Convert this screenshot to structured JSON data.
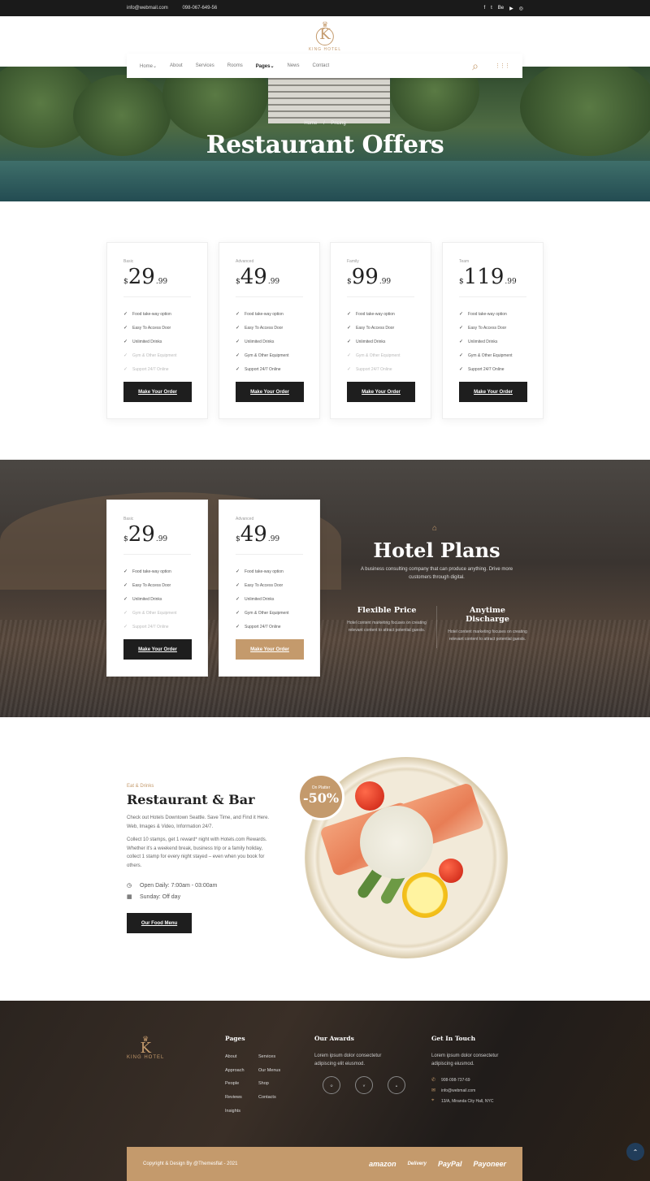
{
  "topbar": {
    "email": "info@webmail.com",
    "phone": "098-067-649-56",
    "social": [
      "f",
      "t",
      "Be",
      "▶",
      "◎"
    ]
  },
  "logo": {
    "letter": "K",
    "name": "KING HOTEL",
    "crown": "♛"
  },
  "nav": {
    "items": [
      "Home",
      "About",
      "Services",
      "Rooms",
      "Pages",
      "News",
      "Contact"
    ],
    "dropdown_marker": "⌄",
    "search_icon": "⌕",
    "grid_icon": "⋮⋮⋮"
  },
  "hero": {
    "breadcrumb_home": "Home",
    "breadcrumb_sep": "/",
    "breadcrumb_current": "Pricing",
    "title": "Restaurant Offers"
  },
  "pricing": {
    "currency": "$",
    "features": [
      "Food take-way option",
      "Easy To Access Door",
      "Unlimited Drinks",
      "Gym & Other Equipment",
      "Support 24/7 Online"
    ],
    "check": "✓",
    "button_label": "Make Your Order",
    "plans": [
      {
        "tier": "Basic",
        "amount": "29",
        "cents": ".99"
      },
      {
        "tier": "Advanced",
        "amount": "49",
        "cents": ".99"
      },
      {
        "tier": "Family",
        "amount": "99",
        "cents": ".99"
      },
      {
        "tier": "Team",
        "amount": "119",
        "cents": ".99"
      }
    ]
  },
  "hotel_plans": {
    "icon": "⌂",
    "title": "Hotel Plans",
    "description": "A business consulting company that can produce anything. Drive more customers through digital.",
    "features": [
      {
        "title": "Flexible Price",
        "text": "Hotel content marketing focuses on creating relevant content to attract potential guests."
      },
      {
        "title": "Anytime Discharge",
        "text": "Hotel content marketing focuses on creating relevant content to attract potential guests."
      }
    ]
  },
  "restaurant": {
    "eyebrow": "Eat & Drinks",
    "title": "Restaurant & Bar",
    "p1": "Check out Hotels Downtown Seattle. Save Time, and Find it Here. Web, Images & Video, Information 24/7.",
    "p2": "Collect 10 stamps, get 1 reward* night with Hotels.com Rewards. Whether it's a weekend break, business trip or a family holiday, collect 1 stamp for every night stayed – even when you book for others.",
    "hours": "Open Daily: 7:00am - 03:00am",
    "sunday": "Sunday: Off day",
    "clock_icon": "◷",
    "calendar_icon": "▦",
    "button": "Our Food Menu",
    "badge_small": "On Platter",
    "badge_big": "-50%"
  },
  "footer": {
    "pages_title": "Pages",
    "pages_col1": [
      "About",
      "Approach",
      "People",
      "Reviews",
      "Insights"
    ],
    "pages_col2": [
      "Services",
      "Our Menus",
      "Shop",
      "Contacts"
    ],
    "awards_title": "Our Awards",
    "awards_text": "Lorem ipsum dolor  consectetur adipiscing elit eiusmod.",
    "touch_title": "Get In Touch",
    "touch_text": "Lorem ipsum dolor  consectetur adipiscing eiusmod.",
    "phone": "908-098-737-69",
    "email": "info@webmail.com",
    "address": "13/A, Miranda City Hall, NYC",
    "phone_icon": "✆",
    "mail_icon": "✉",
    "pin_icon": "⌖",
    "copyright": "Copyright & Design By @Themesflat - 2021",
    "payments": [
      "amazon",
      "Delivery",
      "PayPal",
      "Payoneer"
    ],
    "to_top": "⌃"
  }
}
